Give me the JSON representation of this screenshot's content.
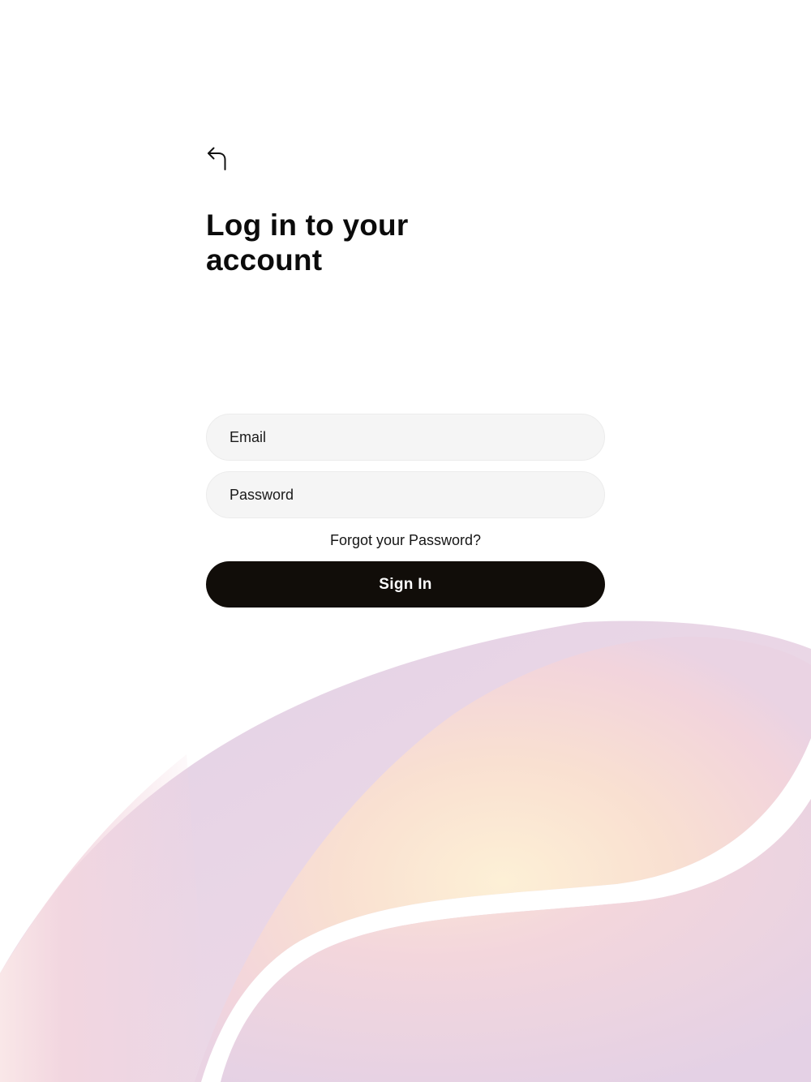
{
  "header": {
    "back_icon": "return-arrow-icon"
  },
  "login": {
    "title": "Log in to your account",
    "email_placeholder": "Email",
    "password_placeholder": "Password",
    "forgot_password_label": "Forgot your Password?",
    "sign_in_label": "Sign In"
  },
  "theme": {
    "button_color": "#110d09",
    "field_background": "#f5f5f5",
    "art_colors": [
      "#e4d3e6",
      "#f3d5dc",
      "#fbe6cf"
    ]
  }
}
